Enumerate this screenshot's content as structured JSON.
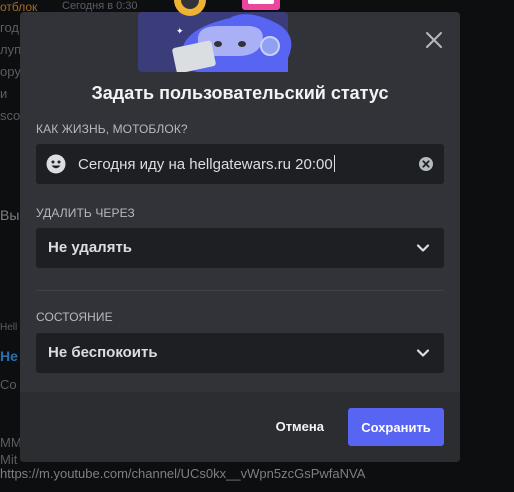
{
  "background": {
    "top_left_fragment": "отблок",
    "top_time": "Сегодня в 0:30",
    "left_frag_1": "год",
    "left_frag_2": "луп",
    "left_frag_3": "ору",
    "left_frag_4": "и",
    "left_frag_5": "sco",
    "left_frag_6": "Вы",
    "left_frag_7": "Hell",
    "left_frag_8": "Не",
    "left_frag_9": "Co",
    "bottom_frag": "MM",
    "bottom_frag_2": "Mit",
    "bottom_url": "https://m.youtube.com/channel/UCs0kx__vWpn5zcGsPwfaNVA"
  },
  "modal": {
    "title": "Задать пользовательский статус",
    "status_label": "КАК ЖИЗНЬ, МОТОБЛОК?",
    "status_value": "Сегодня иду на hellgatewars.ru 20:00",
    "clear_after_label": "УДАЛИТЬ ЧЕРЕЗ",
    "clear_after_value": "Не удалять",
    "state_label": "СОСТОЯНИЕ",
    "state_value": "Не беспокоить",
    "cancel_label": "Отмена",
    "save_label": "Сохранить"
  },
  "colors": {
    "accent": "#5865f2",
    "modal_bg": "#313338",
    "input_bg": "#1e1f22"
  },
  "icons": [
    "close-icon",
    "emoji-icon",
    "clear-icon",
    "chevron-down-icon"
  ]
}
